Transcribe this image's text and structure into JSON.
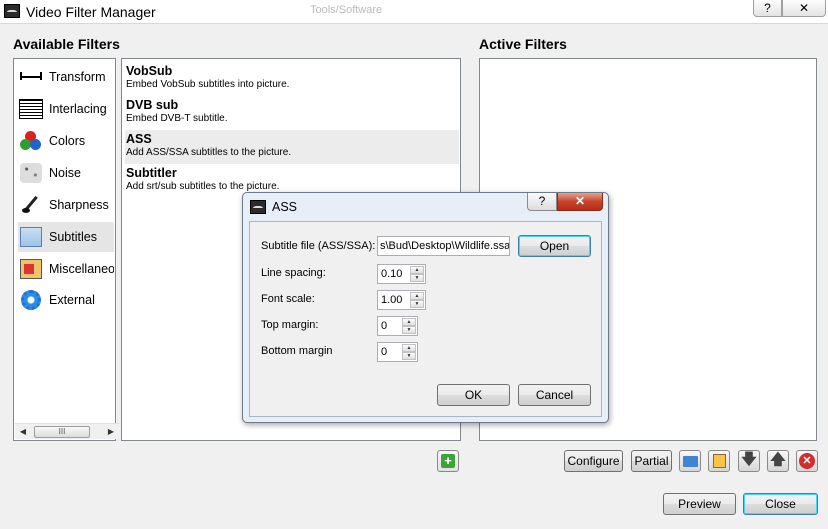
{
  "window": {
    "title": "Video Filter Manager",
    "help_glyph": "?",
    "close_glyph": "✕",
    "background_text": "Tools/Software"
  },
  "available_filters": {
    "heading": "Available Filters",
    "categories": [
      {
        "label": "Transform",
        "icon": "transform-icon"
      },
      {
        "label": "Interlacing",
        "icon": "interlacing-icon"
      },
      {
        "label": "Colors",
        "icon": "colors-icon"
      },
      {
        "label": "Noise",
        "icon": "noise-icon"
      },
      {
        "label": "Sharpness",
        "icon": "sharpness-icon"
      },
      {
        "label": "Subtitles",
        "icon": "subtitles-icon",
        "selected": true
      },
      {
        "label": "Miscellaneous",
        "icon": "miscellaneous-icon"
      },
      {
        "label": "External",
        "icon": "external-icon"
      }
    ],
    "scroll_thumb_grip": "III",
    "filters": [
      {
        "name": "VobSub",
        "description": "Embed VobSub subtitles into picture."
      },
      {
        "name": "DVB sub",
        "description": "Embed DVB-T subtitle."
      },
      {
        "name": "ASS",
        "description": "Add ASS/SSA subtitles to the picture.",
        "selected": true
      },
      {
        "name": "Subtitler",
        "description": "Add srt/sub subtitles to the picture."
      }
    ]
  },
  "active_filters": {
    "heading": "Active Filters",
    "items": []
  },
  "toolbar": {
    "configure_label": "Configure",
    "partial_label": "Partial",
    "add_glyph": "+",
    "down_glyph": "🡇",
    "up_glyph": "🡅",
    "remove_glyph": "✕"
  },
  "footer": {
    "preview_label": "Preview",
    "close_label": "Close"
  },
  "ass_dialog": {
    "title": "ASS",
    "help_glyph": "?",
    "close_glyph": "✕",
    "subtitle_file_label": "Subtitle file (ASS/SSA):",
    "subtitle_file_value": "s\\Bud\\Desktop\\Wildlife.ssa",
    "open_label": "Open",
    "line_spacing_label": "Line spacing:",
    "line_spacing_value": "0.10",
    "font_scale_label": "Font scale:",
    "font_scale_value": "1.00",
    "top_margin_label": "Top margin:",
    "top_margin_value": "0",
    "bottom_margin_label": "Bottom margin",
    "bottom_margin_value": "0",
    "ok_label": "OK",
    "cancel_label": "Cancel"
  },
  "colors": {
    "selection": "#e5e5e5",
    "dialog_frame": "#e6eef8",
    "close_red": "#c7452c",
    "default_button_glow": "#48d5fb"
  }
}
